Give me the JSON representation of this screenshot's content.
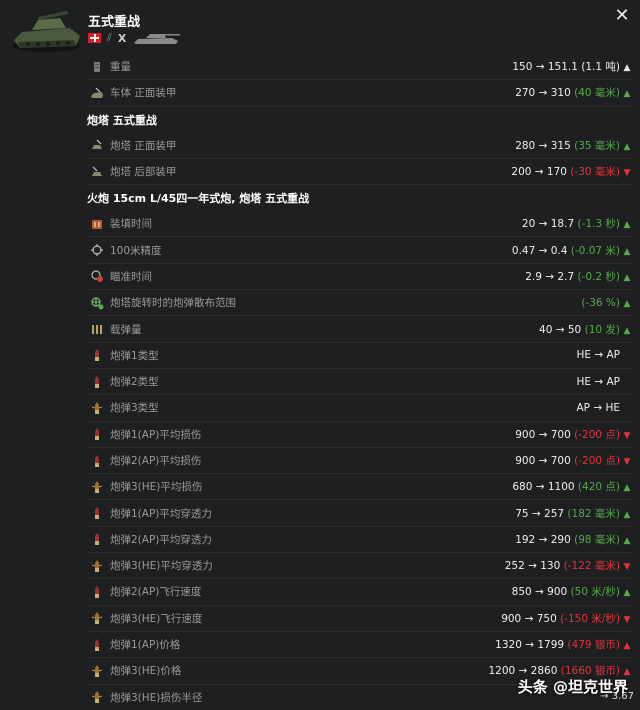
{
  "header": {
    "tank_name": "五式重战",
    "tier": "X",
    "close_icon": "close-icon"
  },
  "rows": [
    {
      "type": "row",
      "icon": "weight-icon",
      "label": "重量",
      "value": "150 → 151.1",
      "delta": "(1.1 吨)",
      "delta_color": "white",
      "arrow": "▲",
      "arrow_color": "white"
    },
    {
      "type": "row",
      "icon": "hull-front-armor-icon",
      "label": "车体 正面装甲",
      "value": "270 → 310",
      "delta": "(40 毫米)",
      "delta_color": "green",
      "arrow": "▲",
      "arrow_color": "green"
    },
    {
      "type": "section",
      "title": "炮塔 五式重战"
    },
    {
      "type": "row",
      "icon": "turret-front-armor-icon",
      "label": "炮塔 正面装甲",
      "value": "280 → 315",
      "delta": "(35 毫米)",
      "delta_color": "green",
      "arrow": "▲",
      "arrow_color": "green"
    },
    {
      "type": "row",
      "icon": "turret-rear-armor-icon",
      "label": "炮塔 后部装甲",
      "value": "200 → 170",
      "delta": "(-30 毫米)",
      "delta_color": "red",
      "arrow": "▼",
      "arrow_color": "red"
    },
    {
      "type": "section",
      "title": "火炮 15cm L/45四一年式炮, 炮塔 五式重战"
    },
    {
      "type": "row",
      "icon": "reload-icon",
      "label": "装填时间",
      "value": "20 → 18.7",
      "delta": "(-1.3 秒)",
      "delta_color": "green",
      "arrow": "▲",
      "arrow_color": "green"
    },
    {
      "type": "row",
      "icon": "crosshair-icon",
      "label": "100米精度",
      "value": "0.47 → 0.4",
      "delta": "(-0.07 米)",
      "delta_color": "green",
      "arrow": "▲",
      "arrow_color": "green"
    },
    {
      "type": "row",
      "icon": "aim-time-icon",
      "label": "瞄准时间",
      "value": "2.9 → 2.7",
      "delta": "(-0.2 秒)",
      "delta_color": "green",
      "arrow": "▲",
      "arrow_color": "green"
    },
    {
      "type": "row",
      "icon": "turret-dispersion-icon",
      "label": "炮塔旋转时的炮弹散布范围",
      "value": "",
      "delta": "(-36 %)",
      "delta_color": "green",
      "arrow": "▲",
      "arrow_color": "green"
    },
    {
      "type": "row",
      "icon": "ammo-capacity-icon",
      "label": "载弹量",
      "value": "40 → 50",
      "delta": "(10 发)",
      "delta_color": "green",
      "arrow": "▲",
      "arrow_color": "green"
    },
    {
      "type": "row",
      "icon": "shell-ap-icon",
      "label": "炮弹1类型",
      "value": "HE → AP",
      "delta": "",
      "delta_color": "white",
      "arrow": "",
      "arrow_color": "white"
    },
    {
      "type": "row",
      "icon": "shell-ap-icon",
      "label": "炮弹2类型",
      "value": "HE → AP",
      "delta": "",
      "delta_color": "white",
      "arrow": "",
      "arrow_color": "white"
    },
    {
      "type": "row",
      "icon": "shell-he-icon",
      "label": "炮弹3类型",
      "value": "AP → HE",
      "delta": "",
      "delta_color": "white",
      "arrow": "",
      "arrow_color": "white"
    },
    {
      "type": "row",
      "icon": "shell-ap-icon",
      "label": "炮弹1(AP)平均损伤",
      "value": "900 → 700",
      "delta": "(-200 点)",
      "delta_color": "red",
      "arrow": "▼",
      "arrow_color": "red"
    },
    {
      "type": "row",
      "icon": "shell-ap-icon",
      "label": "炮弹2(AP)平均损伤",
      "value": "900 → 700",
      "delta": "(-200 点)",
      "delta_color": "red",
      "arrow": "▼",
      "arrow_color": "red"
    },
    {
      "type": "row",
      "icon": "shell-he-icon",
      "label": "炮弹3(HE)平均损伤",
      "value": "680 → 1100",
      "delta": "(420 点)",
      "delta_color": "green",
      "arrow": "▲",
      "arrow_color": "green"
    },
    {
      "type": "row",
      "icon": "shell-ap-icon",
      "label": "炮弹1(AP)平均穿透力",
      "value": "75 → 257",
      "delta": "(182 毫米)",
      "delta_color": "green",
      "arrow": "▲",
      "arrow_color": "green"
    },
    {
      "type": "row",
      "icon": "shell-ap-icon",
      "label": "炮弹2(AP)平均穿透力",
      "value": "192 → 290",
      "delta": "(98 毫米)",
      "delta_color": "green",
      "arrow": "▲",
      "arrow_color": "green"
    },
    {
      "type": "row",
      "icon": "shell-he-icon",
      "label": "炮弹3(HE)平均穿透力",
      "value": "252 → 130",
      "delta": "(-122 毫米)",
      "delta_color": "red",
      "arrow": "▼",
      "arrow_color": "red"
    },
    {
      "type": "row",
      "icon": "shell-ap-icon",
      "label": "炮弹2(AP)飞行速度",
      "value": "850 → 900",
      "delta": "(50 米/秒)",
      "delta_color": "green",
      "arrow": "▲",
      "arrow_color": "green"
    },
    {
      "type": "row",
      "icon": "shell-he-icon",
      "label": "炮弹3(HE)飞行速度",
      "value": "900 → 750",
      "delta": "(-150 米/秒)",
      "delta_color": "red",
      "arrow": "▼",
      "arrow_color": "red"
    },
    {
      "type": "row",
      "icon": "shell-ap-icon",
      "label": "炮弹1(AP)价格",
      "value": "1320 → 1799",
      "delta": "(479 银币)",
      "delta_color": "red",
      "arrow": "▲",
      "arrow_color": "red"
    },
    {
      "type": "row",
      "icon": "shell-he-icon",
      "label": "炮弹3(HE)价格",
      "value": "1200 → 2860",
      "delta": "(1660 银币)",
      "delta_color": "red",
      "arrow": "▲",
      "arrow_color": "red"
    },
    {
      "type": "row",
      "icon": "shell-he-icon",
      "label": "炮弹3(HE)损伤半径",
      "value": "",
      "delta": "",
      "delta_color": "white",
      "arrow": "",
      "arrow_color": "white"
    }
  ],
  "watermark": {
    "text": "头条 @坦克世界",
    "trailing_value": "→ 3.67"
  },
  "colors": {
    "background": "#1e1f21",
    "positive": "#58a94a",
    "negative": "#e2343a",
    "text": "#f0f0f0",
    "label": "#9a9a9a"
  }
}
